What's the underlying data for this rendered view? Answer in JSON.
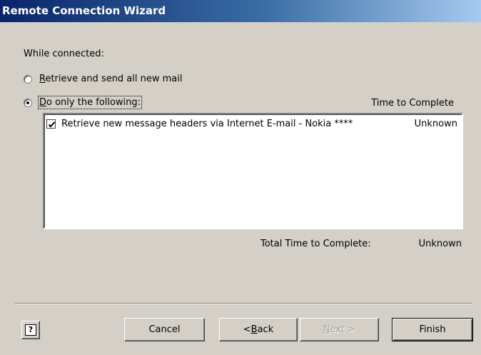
{
  "window": {
    "title": "Remote Connection Wizard"
  },
  "section": {
    "label": "While connected:"
  },
  "options": [
    {
      "label": "Retrieve and send all new mail",
      "mnemonic": "R",
      "checked": false
    },
    {
      "label": "Do only the following:",
      "mnemonic": "D",
      "checked": true
    }
  ],
  "list": {
    "column_header": "Time to Complete",
    "items": [
      {
        "text": "Retrieve new message headers via Internet E-mail - Nokia ****",
        "time": "Unknown",
        "checked": true
      }
    ]
  },
  "total": {
    "label": "Total Time to Complete:",
    "value": "Unknown"
  },
  "buttons": {
    "help": "?",
    "cancel": "Cancel",
    "back": "< Back",
    "next": "Next >",
    "finish": "Finish"
  }
}
